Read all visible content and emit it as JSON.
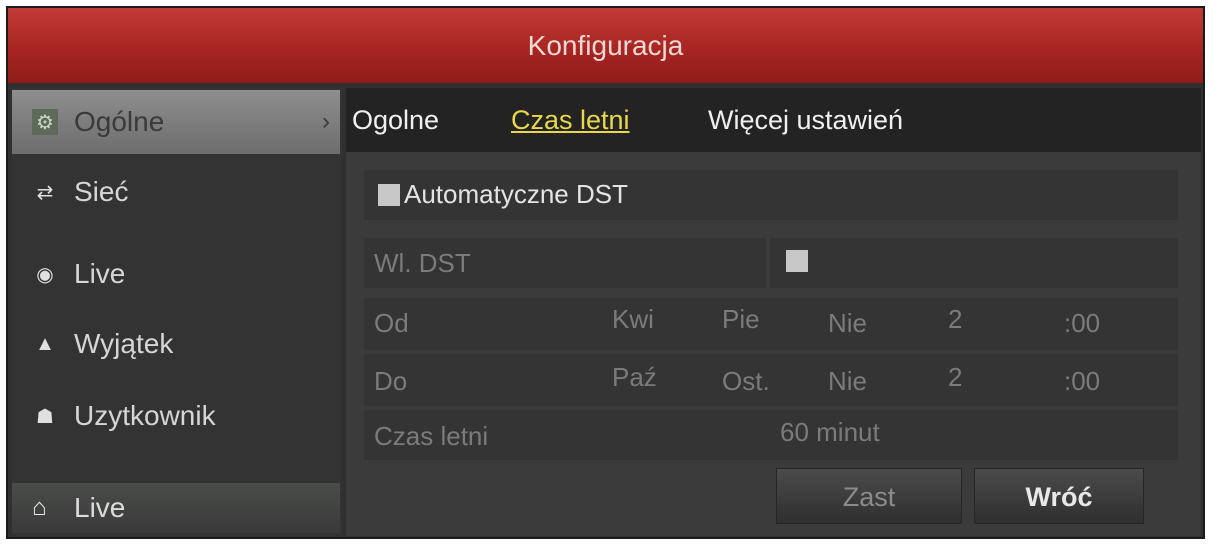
{
  "window": {
    "title": "Konfiguracja"
  },
  "sidebar": {
    "items": [
      {
        "label": "Ogólne",
        "icon": "gear-icon",
        "active": true,
        "arrow": "›"
      },
      {
        "label": "Sieć",
        "icon": "network-icon"
      },
      {
        "label": "Live",
        "icon": "eye-icon"
      },
      {
        "label": "Wyjątek",
        "icon": "warning-icon"
      },
      {
        "label": "Uzytkownik",
        "icon": "users-icon"
      }
    ],
    "live_button": {
      "label": "Live",
      "icon": "home-icon"
    }
  },
  "tabs": [
    {
      "label": "Ogolne"
    },
    {
      "label": "Czas letni",
      "active": true
    },
    {
      "label": "Więcej ustawień"
    }
  ],
  "dst": {
    "auto_label": "Automatyczne DST",
    "enable_label": "Wl. DST",
    "from": {
      "label": "Od",
      "month": "Kwi",
      "week": "Pie",
      "day": "Nie",
      "hour": "2",
      "minute": ":00"
    },
    "to": {
      "label": "Do",
      "month": "Paź",
      "week": "Ost.",
      "day": "Nie",
      "hour": "2",
      "minute": ":00"
    },
    "bias": {
      "label": "Czas letni",
      "value": "60 minut"
    }
  },
  "buttons": {
    "apply": "Zast",
    "back": "Wróć"
  },
  "colors": {
    "title_bar": "#a82522",
    "active_tab": "#e8d84a"
  }
}
